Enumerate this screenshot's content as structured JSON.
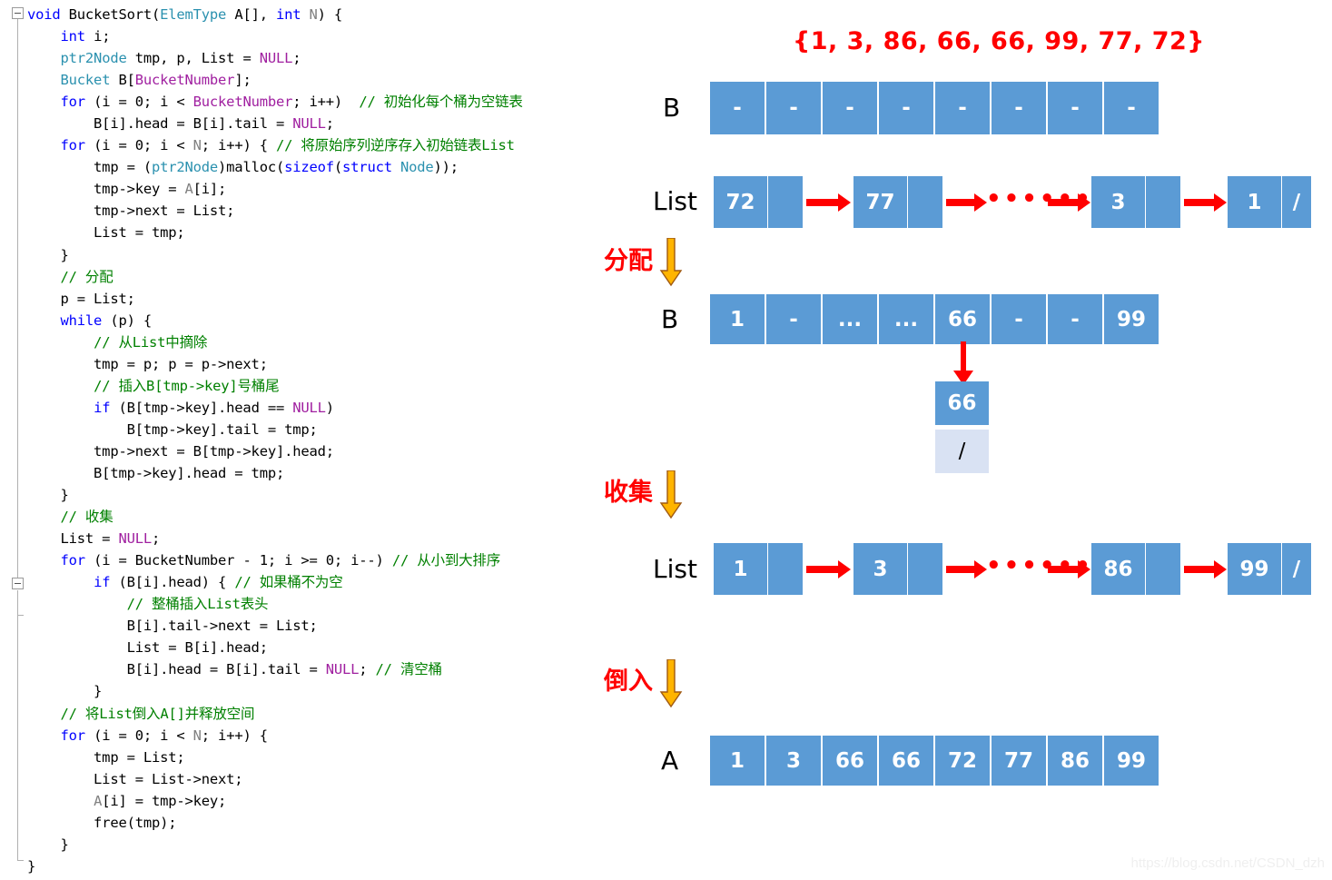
{
  "code": {
    "language": "c",
    "lines": [
      [
        {
          "t": "void ",
          "c": "kw"
        },
        {
          "t": "BucketSort(",
          "c": ""
        },
        {
          "t": "ElemType",
          "c": "typ"
        },
        {
          "t": " A[], ",
          "c": ""
        },
        {
          "t": "int",
          "c": "kw"
        },
        {
          "t": " ",
          "c": ""
        },
        {
          "t": "N",
          "c": "gry"
        },
        {
          "t": ") {",
          "c": ""
        }
      ],
      [
        {
          "t": "    ",
          "c": ""
        },
        {
          "t": "int",
          "c": "kw"
        },
        {
          "t": " i;",
          "c": ""
        }
      ],
      [
        {
          "t": "    ",
          "c": ""
        },
        {
          "t": "ptr2Node",
          "c": "typ"
        },
        {
          "t": " tmp, p, List = ",
          "c": ""
        },
        {
          "t": "NULL",
          "c": "mac"
        },
        {
          "t": ";",
          "c": ""
        }
      ],
      [
        {
          "t": "    ",
          "c": ""
        },
        {
          "t": "Bucket",
          "c": "typ"
        },
        {
          "t": " B[",
          "c": ""
        },
        {
          "t": "BucketNumber",
          "c": "mac"
        },
        {
          "t": "];",
          "c": ""
        }
      ],
      [
        {
          "t": "    ",
          "c": ""
        },
        {
          "t": "for",
          "c": "kw"
        },
        {
          "t": " (i = 0; i < ",
          "c": ""
        },
        {
          "t": "BucketNumber",
          "c": "mac"
        },
        {
          "t": "; i++)  ",
          "c": ""
        },
        {
          "t": "// 初始化每个桶为空链表",
          "c": "cmt"
        }
      ],
      [
        {
          "t": "        B[i].head = B[i].tail = ",
          "c": ""
        },
        {
          "t": "NULL",
          "c": "mac"
        },
        {
          "t": ";",
          "c": ""
        }
      ],
      [
        {
          "t": "    ",
          "c": ""
        },
        {
          "t": "for",
          "c": "kw"
        },
        {
          "t": " (i = 0; i < ",
          "c": ""
        },
        {
          "t": "N",
          "c": "gry"
        },
        {
          "t": "; i++) { ",
          "c": ""
        },
        {
          "t": "// 将原始序列逆序存入初始链表List",
          "c": "cmt"
        }
      ],
      [
        {
          "t": "        tmp = (",
          "c": ""
        },
        {
          "t": "ptr2Node",
          "c": "typ"
        },
        {
          "t": ")malloc(",
          "c": ""
        },
        {
          "t": "sizeof",
          "c": "kw"
        },
        {
          "t": "(",
          "c": ""
        },
        {
          "t": "struct",
          "c": "kw"
        },
        {
          "t": " ",
          "c": ""
        },
        {
          "t": "Node",
          "c": "typ"
        },
        {
          "t": "));",
          "c": ""
        }
      ],
      [
        {
          "t": "        tmp->key = ",
          "c": ""
        },
        {
          "t": "A",
          "c": "gry"
        },
        {
          "t": "[i];",
          "c": ""
        }
      ],
      [
        {
          "t": "        tmp->next = List;",
          "c": ""
        }
      ],
      [
        {
          "t": "        List = tmp;",
          "c": ""
        }
      ],
      [
        {
          "t": "    }",
          "c": ""
        }
      ],
      [
        {
          "t": "    ",
          "c": ""
        },
        {
          "t": "// 分配",
          "c": "cmt"
        }
      ],
      [
        {
          "t": "    p = List;",
          "c": ""
        }
      ],
      [
        {
          "t": "    ",
          "c": ""
        },
        {
          "t": "while",
          "c": "kw"
        },
        {
          "t": " (p) {",
          "c": ""
        }
      ],
      [
        {
          "t": "        ",
          "c": ""
        },
        {
          "t": "// 从List中摘除",
          "c": "cmt"
        }
      ],
      [
        {
          "t": "        tmp = p; p = p->next;",
          "c": ""
        }
      ],
      [
        {
          "t": "        ",
          "c": ""
        },
        {
          "t": "// 插入B[tmp->key]号桶尾",
          "c": "cmt"
        }
      ],
      [
        {
          "t": "        ",
          "c": ""
        },
        {
          "t": "if",
          "c": "kw"
        },
        {
          "t": " (B[tmp->key].head == ",
          "c": ""
        },
        {
          "t": "NULL",
          "c": "mac"
        },
        {
          "t": ")",
          "c": ""
        }
      ],
      [
        {
          "t": "            B[tmp->key].tail = tmp;",
          "c": ""
        }
      ],
      [
        {
          "t": "        tmp->next = B[tmp->key].head;",
          "c": ""
        }
      ],
      [
        {
          "t": "        B[tmp->key].head = tmp;",
          "c": ""
        }
      ],
      [
        {
          "t": "    }",
          "c": ""
        }
      ],
      [
        {
          "t": "    ",
          "c": ""
        },
        {
          "t": "// 收集",
          "c": "cmt"
        }
      ],
      [
        {
          "t": "    List = ",
          "c": ""
        },
        {
          "t": "NULL",
          "c": "mac"
        },
        {
          "t": ";",
          "c": ""
        }
      ],
      [
        {
          "t": "    ",
          "c": ""
        },
        {
          "t": "for",
          "c": "kw"
        },
        {
          "t": " (i = BucketNumber - 1; i >= 0; i--) ",
          "c": ""
        },
        {
          "t": "// 从小到大排序",
          "c": "cmt"
        }
      ],
      [
        {
          "t": "        ",
          "c": ""
        },
        {
          "t": "if",
          "c": "kw"
        },
        {
          "t": " (B[i].head) { ",
          "c": ""
        },
        {
          "t": "// 如果桶不为空",
          "c": "cmt"
        }
      ],
      [
        {
          "t": "            ",
          "c": ""
        },
        {
          "t": "// 整桶插入List表头",
          "c": "cmt"
        }
      ],
      [
        {
          "t": "            B[i].tail->next = List;",
          "c": ""
        }
      ],
      [
        {
          "t": "            List = B[i].head;",
          "c": ""
        }
      ],
      [
        {
          "t": "            B[i].head = B[i].tail = ",
          "c": ""
        },
        {
          "t": "NULL",
          "c": "mac"
        },
        {
          "t": "; ",
          "c": ""
        },
        {
          "t": "// 清空桶",
          "c": "cmt"
        }
      ],
      [
        {
          "t": "        }",
          "c": ""
        }
      ],
      [
        {
          "t": "    ",
          "c": ""
        },
        {
          "t": "// 将List倒入A[]并释放空间",
          "c": "cmt"
        }
      ],
      [
        {
          "t": "    ",
          "c": ""
        },
        {
          "t": "for",
          "c": "kw"
        },
        {
          "t": " (i = 0; i < ",
          "c": ""
        },
        {
          "t": "N",
          "c": "gry"
        },
        {
          "t": "; i++) {",
          "c": ""
        }
      ],
      [
        {
          "t": "        tmp = List;",
          "c": ""
        }
      ],
      [
        {
          "t": "        List = List->next;",
          "c": ""
        }
      ],
      [
        {
          "t": "        ",
          "c": ""
        },
        {
          "t": "A",
          "c": "gry"
        },
        {
          "t": "[i] = tmp->key;",
          "c": ""
        }
      ],
      [
        {
          "t": "        free(tmp);",
          "c": ""
        }
      ],
      [
        {
          "t": "    }",
          "c": ""
        }
      ],
      [
        {
          "t": "}",
          "c": ""
        }
      ]
    ]
  },
  "diagram": {
    "title": "{1, 3, 86, 66, 66, 99, 77, 72}",
    "colors": {
      "cell_blue": "#5b9bd5",
      "cell_pale": "#d9e2f3",
      "arrow_red": "#ff0000",
      "step_orange": "#ffb400",
      "label_red": "#ff0000"
    },
    "bucket_row_initial": {
      "label": "B",
      "cells": [
        "-",
        "-",
        "-",
        "-",
        "-",
        "-",
        "-",
        "-"
      ]
    },
    "list_row_initial": {
      "label": "List",
      "nodes": [
        "72",
        "77",
        "3",
        "1"
      ],
      "terminator": "/",
      "ellipsis": "••••••"
    },
    "step_distribute": {
      "label": "分配"
    },
    "bucket_row_filled": {
      "label": "B",
      "cells": [
        "1",
        "-",
        "...",
        "...",
        "66",
        "-",
        "-",
        "99"
      ]
    },
    "bucket_chain": {
      "value": "66",
      "terminator": "/"
    },
    "step_collect": {
      "label": "收集"
    },
    "list_row_sorted": {
      "label": "List",
      "nodes": [
        "1",
        "3",
        "86",
        "99"
      ],
      "terminator": "/",
      "ellipsis": "••••••"
    },
    "step_pour": {
      "label": "倒入"
    },
    "array_row_final": {
      "label": "A",
      "cells": [
        "1",
        "3",
        "66",
        "66",
        "72",
        "77",
        "86",
        "99"
      ]
    }
  },
  "watermark": "https://blog.csdn.net/CSDN_dzh"
}
